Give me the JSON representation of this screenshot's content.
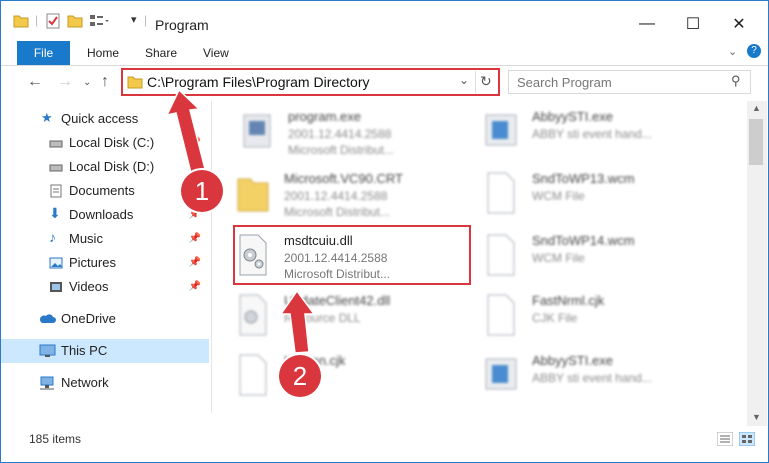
{
  "window": {
    "title": "Program",
    "minimize": "—",
    "maximize": "☐",
    "close": "✕"
  },
  "ribbon": {
    "file": "File",
    "home": "Home",
    "share": "Share",
    "view": "View"
  },
  "address": {
    "path": "C:\\Program Files\\Program Directory"
  },
  "search": {
    "placeholder": "Search Program"
  },
  "sidebar": [
    {
      "label": "Quick access",
      "icon": "star-icon",
      "pinned": false
    },
    {
      "label": "Local Disk (C:)",
      "icon": "drive-icon",
      "pinned": true
    },
    {
      "label": "Local Disk (D:)",
      "icon": "drive-icon",
      "pinned": true
    },
    {
      "label": "Documents",
      "icon": "document-icon",
      "pinned": true
    },
    {
      "label": "Downloads",
      "icon": "download-icon",
      "pinned": true
    },
    {
      "label": "Music",
      "icon": "music-icon",
      "pinned": true
    },
    {
      "label": "Pictures",
      "icon": "pictures-icon",
      "pinned": true
    },
    {
      "label": "Videos",
      "icon": "videos-icon",
      "pinned": true
    },
    {
      "label": "OneDrive",
      "icon": "cloud-icon",
      "pinned": false
    },
    {
      "label": "This PC",
      "icon": "computer-icon",
      "pinned": false,
      "selected": true
    },
    {
      "label": "Network",
      "icon": "network-icon",
      "pinned": false
    }
  ],
  "files": [
    {
      "name": "program.exe",
      "line2": "2001.12.4414.2588",
      "line3": "Microsoft Distribut..."
    },
    {
      "name": "Microsoft.VC90.CRT",
      "line2": "2001.12.4414.2588",
      "line3": "Microsoft Distribut..."
    },
    {
      "name": "msdtcuiu.dll",
      "line2": "2001.12.4414.2588",
      "line3": "Microsoft Distribut..."
    },
    {
      "name": "UpdateClient42.dll",
      "line2": "Resource DLL",
      "line3": ""
    },
    {
      "name": "Korean.cjk",
      "line2": "",
      "line3": ""
    },
    {
      "name": "AbbyySTI.exe",
      "line2": "ABBY sti event hand...",
      "line3": ""
    },
    {
      "name": "SndToWP13.wcm",
      "line2": "WCM File",
      "line3": ""
    },
    {
      "name": "SndToWP14.wcm",
      "line2": "WCM File",
      "line3": ""
    },
    {
      "name": "FastNrml.cjk",
      "line2": "CJK File",
      "line3": ""
    },
    {
      "name": "AbbyySTI.exe",
      "line2": "ABBY sti event hand...",
      "line3": ""
    }
  ],
  "status": {
    "items": "185 items"
  },
  "annotations": {
    "step1": "1",
    "step2": "2",
    "color": "#d9363e"
  }
}
